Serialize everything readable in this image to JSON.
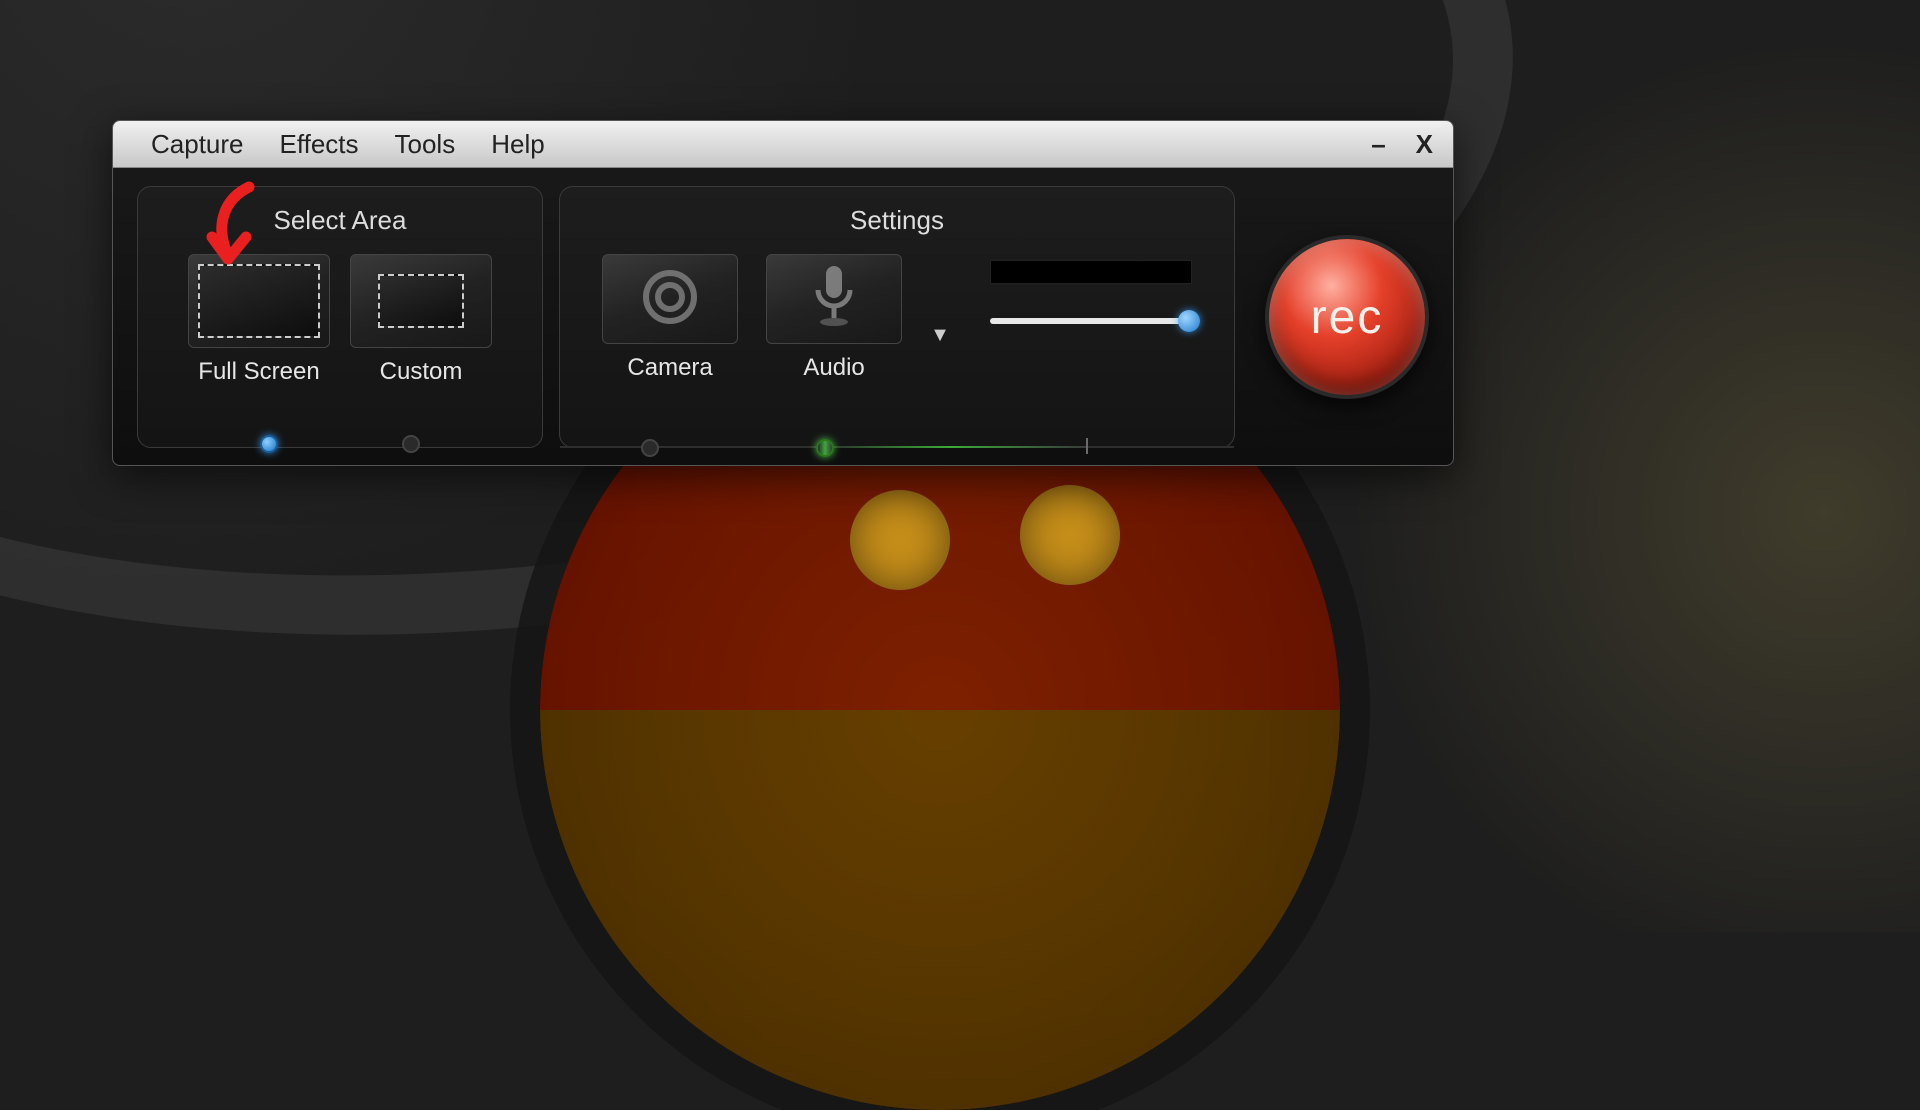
{
  "menu": {
    "capture": "Capture",
    "effects": "Effects",
    "tools": "Tools",
    "help": "Help"
  },
  "window_controls": {
    "minimize": "–",
    "close": "X"
  },
  "panels": {
    "select_area_title": "Select Area",
    "settings_title": "Settings"
  },
  "select_area": {
    "full_screen_label": "Full Screen",
    "custom_label": "Custom",
    "selected": "full_screen"
  },
  "settings": {
    "camera_label": "Camera",
    "audio_label": "Audio",
    "audio_dropdown_icon": "▼",
    "volume_pct": 100
  },
  "record_button_label": "rec",
  "icons": {
    "camera": "camera-icon",
    "microphone": "microphone-icon"
  }
}
